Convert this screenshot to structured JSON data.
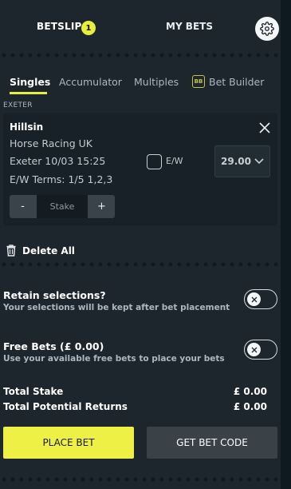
{
  "header": {
    "betslip_label": "BETSLIP",
    "betslip_count": "1",
    "mybets_label": "MY BETS",
    "settings_icon": "gear-icon"
  },
  "subtabs": {
    "singles": "Singles",
    "accumulator": "Accumulator",
    "multiples": "Multiples",
    "bet_builder_badge": "BB",
    "bet_builder": "Bet Builder"
  },
  "meeting": "EXETER",
  "selection": {
    "runner": "Hillsin",
    "market": "Horse Racing UK",
    "event": "Exeter 10/03 15:25",
    "terms": "E/W Terms: 1/5 1,2,3",
    "ew_label": "E/W",
    "odds": "29.00",
    "stake_placeholder": "Stake",
    "minus": "-",
    "plus": "+"
  },
  "delete_all": "Delete All",
  "options": {
    "retain_title": "Retain selections?",
    "retain_desc": "Your selections will be kept after bet placement",
    "free_title": "Free Bets (£ 0.00)",
    "free_desc": "Use your available free bets to place your bets"
  },
  "totals": {
    "stake_label": "Total Stake",
    "stake_value": "£ 0.00",
    "returns_label": "Total Potential Returns",
    "returns_value": "£ 0.00"
  },
  "buttons": {
    "place_bet": "PLACE BET",
    "get_code": "GET BET CODE"
  },
  "colors": {
    "accent": "#e7ef38",
    "background": "#1d262c",
    "card": "#182127"
  }
}
